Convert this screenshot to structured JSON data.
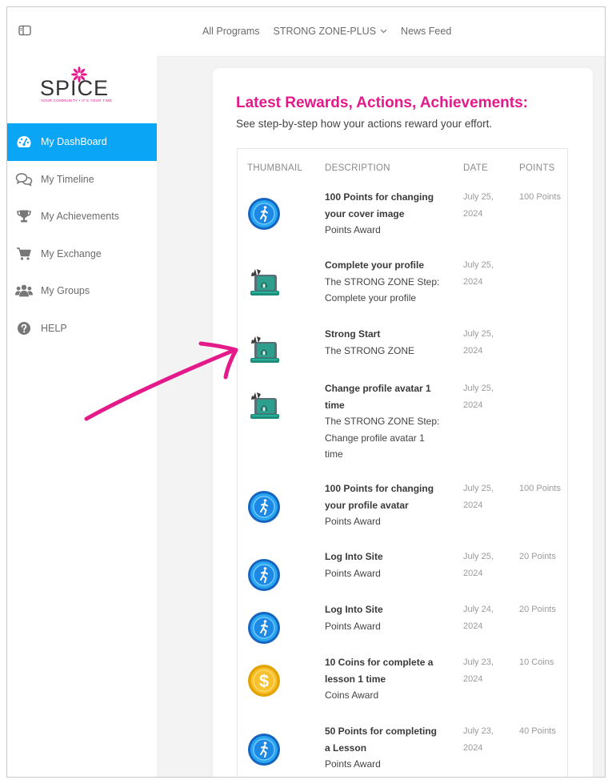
{
  "logo": {
    "text": "SPICE",
    "tagline": "YOUR COMMUNITY • IT'S YOUR TIME"
  },
  "sidebar": {
    "items": [
      {
        "label": "My DashBoard",
        "icon": "dashboard-icon",
        "active": true
      },
      {
        "label": "My Timeline",
        "icon": "chat-bubbles-icon",
        "active": false
      },
      {
        "label": "My Achievements",
        "icon": "trophy-icon",
        "active": false
      },
      {
        "label": "My Exchange",
        "icon": "cart-icon",
        "active": false
      },
      {
        "label": "My Groups",
        "icon": "group-icon",
        "active": false
      },
      {
        "label": "HELP",
        "icon": "question-icon",
        "active": false
      }
    ]
  },
  "topnav": {
    "items": [
      "All Programs",
      "STRONG ZONE-PLUS",
      "News Feed"
    ]
  },
  "main": {
    "title": "Latest Rewards, Actions, Achievements:",
    "subtitle": "See step-by-step how your actions reward your effort.",
    "columns": [
      "THUMBNAIL",
      "DESCRIPTION",
      "DATE",
      "POINTS"
    ],
    "rows": [
      {
        "thumb": "points-badge-icon",
        "title": "100 Points for changing your cover image",
        "subtitle": "Points Award",
        "date": "July 25, 2024",
        "points": "100 Points"
      },
      {
        "thumb": "achievement-chest-icon",
        "title": "Complete your profile",
        "subtitle": "The STRONG ZONE Step: Complete your profile",
        "date": "July 25, 2024",
        "points": ""
      },
      {
        "thumb": "achievement-chest-icon",
        "title": "Strong Start",
        "subtitle": "The STRONG ZONE",
        "date": "July 25, 2024",
        "points": ""
      },
      {
        "thumb": "achievement-chest-icon",
        "title": "Change profile avatar 1 time",
        "subtitle": "The STRONG ZONE Step: Change profile avatar 1 time",
        "date": "July 25, 2024",
        "points": ""
      },
      {
        "thumb": "points-badge-icon",
        "title": "100 Points for changing your profile avatar",
        "subtitle": "Points Award",
        "date": "July 25, 2024",
        "points": "100 Points"
      },
      {
        "thumb": "points-badge-icon",
        "title": "Log Into Site",
        "subtitle": "Points Award",
        "date": "July 25, 2024",
        "points": "20 Points"
      },
      {
        "thumb": "points-badge-icon",
        "title": "Log Into Site",
        "subtitle": "Points Award",
        "date": "July 24, 2024",
        "points": "20 Points"
      },
      {
        "thumb": "coin-icon",
        "title": "10 Coins for complete a lesson 1 time",
        "subtitle": "Coins Award",
        "date": "July 23, 2024",
        "points": "10 Coins"
      },
      {
        "thumb": "points-badge-icon",
        "title": "50 Points for completing a Lesson",
        "subtitle": "Points Award",
        "date": "July 23, 2024",
        "points": "40 Points"
      }
    ]
  },
  "colors": {
    "accent": "#0aa5f5",
    "heading": "#e4198a",
    "arrow": "#e4198a"
  }
}
